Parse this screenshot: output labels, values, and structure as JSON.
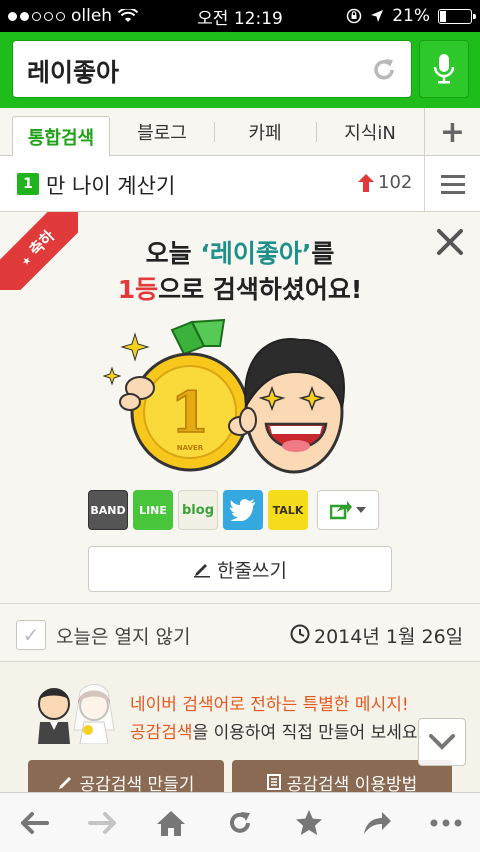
{
  "status_bar": {
    "carrier": "olleh",
    "time": "오전 12:19",
    "battery": "21%"
  },
  "search": {
    "query": "레이좋아"
  },
  "tabs": [
    {
      "label": "통합검색",
      "active": true
    },
    {
      "label": "블로그"
    },
    {
      "label": "카페"
    },
    {
      "label": "지식iN"
    }
  ],
  "ranking": {
    "rank": "1",
    "keyword": "만 나이 계산기",
    "change": "102"
  },
  "congrats": {
    "ribbon": "축하",
    "line1_pre": "오늘 ",
    "line1_kw": "‘레이좋아’",
    "line1_post": "를",
    "line2_rank": "1등",
    "line2_post": "으로 검색하셨어요!",
    "medal_text": "NAVER",
    "medal_num": "1",
    "share": {
      "band": "BAND",
      "line": "LINE",
      "blog": "blog",
      "kakao": "TALK"
    },
    "write_label": "한줄쓰기"
  },
  "dismiss": {
    "label": "오늘은 열지 않기",
    "date": "2014년 1월 26일"
  },
  "promo": {
    "line1": "네이버 검색어로 전하는 특별한 메시지!",
    "line2_link": "공감검색",
    "line2_rest": "을 이용하여 직접 만들어 보세요.",
    "btn_make": "공감검색 만들기",
    "btn_howto": "공감검색 이용방법"
  },
  "colors": {
    "naver_green": "#1fbd1c",
    "accent_red": "#e03a3a",
    "keyword_teal": "#1f8f8a"
  }
}
